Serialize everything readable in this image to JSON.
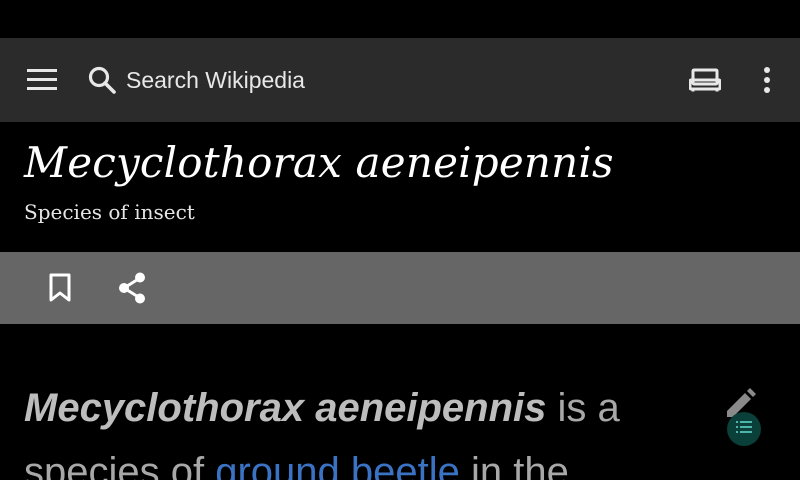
{
  "toolbar": {
    "search_placeholder": "Search Wikipedia"
  },
  "icons": {
    "menu": "menu-icon",
    "search": "search-icon",
    "reading_lists": "reading-list-icon",
    "overflow": "more-vert-icon",
    "bookmark": "bookmark-icon",
    "share": "share-icon",
    "edit": "pencil-icon",
    "toc": "list-icon"
  },
  "article": {
    "title": "Mecyclothorax aeneipennis",
    "description": "Species of insect",
    "lead": {
      "bold_name": "Mecyclothorax aeneipennis",
      "text_1": " is a species of ",
      "link_1": "ground beetle",
      "text_2": " in the"
    }
  },
  "colors": {
    "toolbar_bg": "#2b2b2b",
    "action_bar_bg": "#666666",
    "link": "#3b73c4",
    "toc_button": "#0b3f3a"
  }
}
